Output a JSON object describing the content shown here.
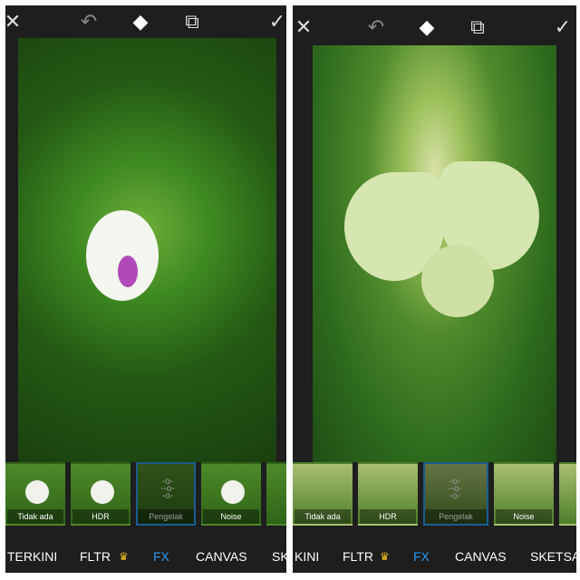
{
  "toolbar": {
    "close": "close-icon",
    "undo": "undo-icon",
    "eraser": "eraser-icon",
    "blend": "blend-icon",
    "apply": "check-icon"
  },
  "effects": [
    {
      "label": "Tidak ada"
    },
    {
      "label": "HDR"
    },
    {
      "label": "Pengelak",
      "selected": true
    },
    {
      "label": "Noise"
    }
  ],
  "left_tabs": [
    "TERKINI",
    "FLTR",
    "FX",
    "CANVAS",
    "SK"
  ],
  "right_tabs": [
    "KINI",
    "FLTR",
    "FX",
    "CANVAS",
    "SKETSA"
  ],
  "active_tab": "FX",
  "colors": {
    "accent": "#2b9af3",
    "crown": "#f0c020",
    "background": "#1e1e1e"
  }
}
